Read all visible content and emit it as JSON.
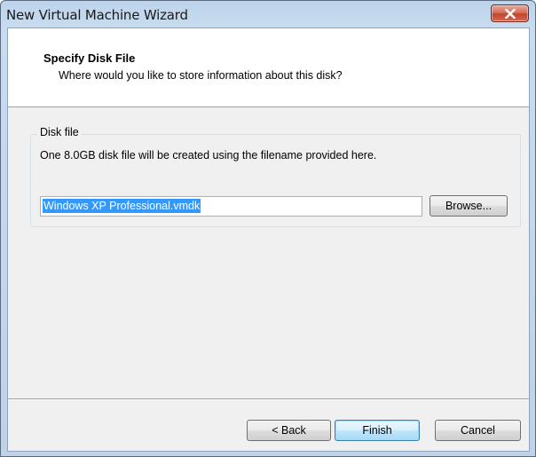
{
  "window": {
    "title": "New Virtual Machine Wizard"
  },
  "header": {
    "title": "Specify Disk File",
    "subtitle": "Where would you like to store information about this disk?"
  },
  "disk_file_group": {
    "label": "Disk file",
    "description": "One 8.0GB disk file will be created using the filename provided here.",
    "filename_value": "Windows XP Professional.vmdk",
    "browse_label": "Browse..."
  },
  "footer": {
    "back_label": "< Back",
    "finish_label": "Finish",
    "cancel_label": "Cancel"
  },
  "icons": {
    "close": "close-icon"
  }
}
